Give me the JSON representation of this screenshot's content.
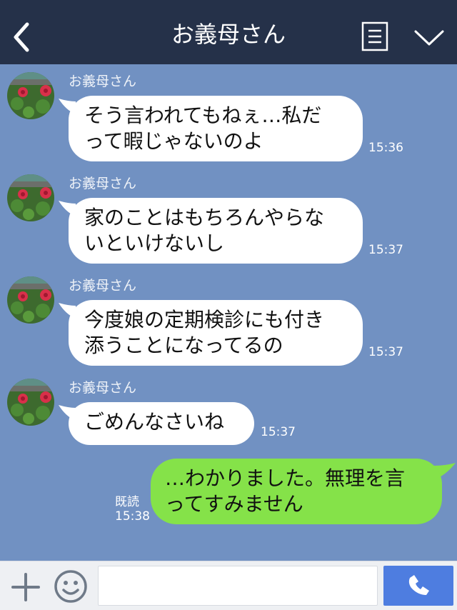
{
  "header": {
    "title": "お義母さん",
    "back_icon": "chevron-left-icon",
    "menu_icon": "document-menu-icon",
    "expand_icon": "chevron-down-icon"
  },
  "messages": [
    {
      "sender": "お義母さん",
      "line1": "そう言われてもねぇ…私だ",
      "line2": "って暇じゃないのよ",
      "time": "15:36"
    },
    {
      "sender": "お義母さん",
      "line1": "家のことはもちろんやらな",
      "line2": "いといけないし",
      "time": "15:37"
    },
    {
      "sender": "お義母さん",
      "line1": "今度娘の定期検診にも付き",
      "line2": "添うことになってるの",
      "time": "15:37"
    },
    {
      "sender": "お義母さん",
      "line1": "ごめんなさいね",
      "time": "15:37"
    }
  ],
  "outgoing": {
    "line1": "…わかりました。無理を言",
    "line2": "ってすみません",
    "read_label": "既読",
    "time": "15:38"
  },
  "input_bar": {
    "plus_icon": "plus-icon",
    "emoji_icon": "smiley-icon",
    "message_value": "",
    "send_icon": "phone-icon"
  },
  "colors": {
    "header_bg": "#253149",
    "chat_bg": "#7191c2",
    "incoming_bubble": "#ffffff",
    "outgoing_bubble": "#85e249",
    "send_button": "#4e7de0"
  }
}
